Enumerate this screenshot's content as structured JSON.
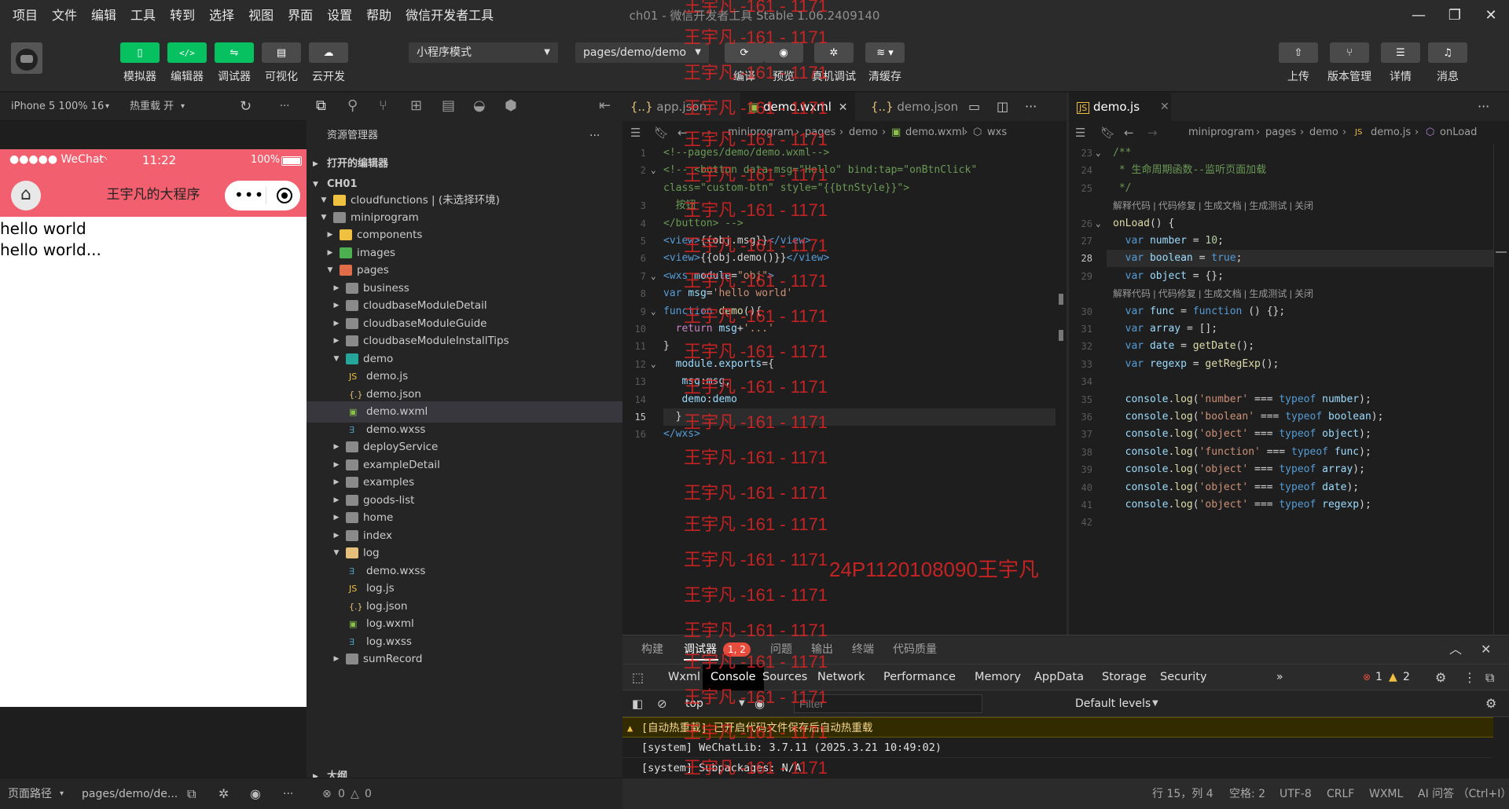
{
  "window": {
    "title": "ch01 - 微信开发者工具 Stable 1.06.2409140",
    "menu": [
      "项目",
      "文件",
      "编辑",
      "工具",
      "转到",
      "选择",
      "视图",
      "界面",
      "设置",
      "帮助",
      "微信开发者工具"
    ]
  },
  "toolbar": {
    "simulator": "模拟器",
    "editor": "编辑器",
    "debugger": "调试器",
    "visual": "可视化",
    "cloud": "云开发",
    "mode_select": "小程序模式",
    "page_select": "pages/demo/demo",
    "compile": "编译",
    "preview": "预览",
    "real_debug": "真机调试",
    "clear_cache": "清缓存",
    "upload": "上传",
    "version": "版本管理",
    "details": "详情",
    "messages": "消息"
  },
  "simulator": {
    "device": "iPhone 5 100% 16",
    "hot_reload": "热重载 开",
    "status_carrier": "●●●●● WeChat",
    "status_time": "11:22",
    "status_battery": "100%",
    "nav_title": "王宇凡的大程序",
    "content": [
      "hello world",
      "hello world..."
    ],
    "bottom_path_label": "页面路径",
    "bottom_path": "pages/demo/de..."
  },
  "explorer": {
    "title": "资源管理器",
    "open_editors": "打开的编辑器",
    "project": "CH01",
    "outline": "大纲",
    "items": [
      {
        "name": "cloudfunctions | (未选择环境)",
        "type": "folder"
      },
      {
        "name": "miniprogram",
        "type": "folder"
      },
      {
        "name": "components",
        "type": "folder"
      },
      {
        "name": "images",
        "type": "folder"
      },
      {
        "name": "pages",
        "type": "folder"
      },
      {
        "name": "business",
        "type": "folder"
      },
      {
        "name": "cloudbaseModuleDetail",
        "type": "folder"
      },
      {
        "name": "cloudbaseModuleGuide",
        "type": "folder"
      },
      {
        "name": "cloudbaseModuleInstallTips",
        "type": "folder"
      },
      {
        "name": "demo",
        "type": "folder"
      },
      {
        "name": "demo.js",
        "type": "js"
      },
      {
        "name": "demo.json",
        "type": "json"
      },
      {
        "name": "demo.wxml",
        "type": "wxml"
      },
      {
        "name": "demo.wxss",
        "type": "wxss"
      },
      {
        "name": "deployService",
        "type": "folder"
      },
      {
        "name": "exampleDetail",
        "type": "folder"
      },
      {
        "name": "examples",
        "type": "folder"
      },
      {
        "name": "goods-list",
        "type": "folder"
      },
      {
        "name": "home",
        "type": "folder"
      },
      {
        "name": "index",
        "type": "folder"
      },
      {
        "name": "log",
        "type": "folder"
      },
      {
        "name": "demo.wxss",
        "type": "wxss"
      },
      {
        "name": "log.js",
        "type": "js"
      },
      {
        "name": "log.json",
        "type": "json"
      },
      {
        "name": "log.wxml",
        "type": "wxml"
      },
      {
        "name": "log.wxss",
        "type": "wxss"
      },
      {
        "name": "sumRecord",
        "type": "folder"
      }
    ],
    "status_errors": "0",
    "status_warnings": "0"
  },
  "editor1": {
    "tabs": [
      "app.json",
      "demo.wxml",
      "demo.json"
    ],
    "breadcrumb": [
      "miniprogram",
      "pages",
      "demo",
      "demo.wxml",
      "wxs"
    ],
    "lines": [
      {
        "n": "1",
        "html": "<span class='c-com'>&lt;!--pages/demo/demo.wxml--&gt;</span>"
      },
      {
        "n": "2",
        "html": "<span class='c-com'>&lt;!-- &lt;button data-msg=\"Hello\" bind:tap=\"onBtnClick\"</span>"
      },
      {
        "n": "",
        "html": "<span class='c-com'>class=\"custom-btn\" style=\"{{btnStyle}}\"&gt;</span>"
      },
      {
        "n": "3",
        "html": "<span class='c-com'>  按钮</span>"
      },
      {
        "n": "4",
        "html": "<span class='c-com'>&lt;/button&gt; --&gt;</span>"
      },
      {
        "n": "5",
        "html": "<span class='c-tag'>&lt;view&gt;</span><span class='c-pl'>{{obj.msg}}</span><span class='c-tag'>&lt;/view&gt;</span>"
      },
      {
        "n": "6",
        "html": "<span class='c-tag'>&lt;view&gt;</span><span class='c-pl'>{{obj.demo()}}</span><span class='c-tag'>&lt;/view&gt;</span>"
      },
      {
        "n": "7",
        "html": "<span class='c-tag'>&lt;wxs</span> <span class='c-attr'>module</span><span class='c-pl'>=</span><span class='c-str'>\"obj\"</span><span class='c-tag'>&gt;</span>"
      },
      {
        "n": "8",
        "html": "<span class='c-kw2'>var</span> <span class='c-var'>msg</span><span class='c-pl'>=</span><span class='c-str'>'hello world'</span>"
      },
      {
        "n": "9",
        "html": "<span class='c-kw2'>function</span> <span class='c-fn'>demo</span><span class='c-pl'>(){</span>"
      },
      {
        "n": "10",
        "html": "  <span class='c-kw'>return</span> <span class='c-var'>msg</span><span class='c-pl'>+</span><span class='c-str'>'...'</span>"
      },
      {
        "n": "11",
        "html": "<span class='c-pl'>}</span>"
      },
      {
        "n": "12",
        "html": "  <span class='c-var'>module</span><span class='c-pl'>.</span><span class='c-var'>exports</span><span class='c-pl'>={</span>"
      },
      {
        "n": "13",
        "html": "   <span class='c-var'>msg</span><span class='c-pl'>:</span><span class='c-var'>msg</span><span class='c-pl'>,</span>"
      },
      {
        "n": "14",
        "html": "   <span class='c-var'>demo</span><span class='c-pl'>:</span><span class='c-var'>demo</span>"
      },
      {
        "n": "15",
        "html": "  <span class='c-pl'>}</span>"
      },
      {
        "n": "16",
        "html": "<span class='c-tag'>&lt;/wxs&gt;</span>"
      }
    ],
    "current_line": "15"
  },
  "editor2": {
    "tabs": [
      "demo.js"
    ],
    "breadcrumb": [
      "miniprogram",
      "pages",
      "demo",
      "demo.js",
      "onLoad"
    ],
    "codelens": "解释代码 | 代码修复 | 生成文档 | 生成测试 | 关闭",
    "lines": [
      {
        "n": "23",
        "html": "<span class='c-com'>/**</span>"
      },
      {
        "n": "24",
        "html": "<span class='c-com'> * 生命周期函数--监听页面加载</span>"
      },
      {
        "n": "25",
        "html": "<span class='c-com'> */</span>"
      },
      {
        "n": "",
        "lens": true
      },
      {
        "n": "26",
        "html": "<span class='c-fn'>onLoad</span><span class='c-pl'>() {</span>"
      },
      {
        "n": "27",
        "html": "  <span class='c-kw2'>var</span> <span class='c-var'>number</span> <span class='c-pl'>=</span> <span class='c-num'>10</span><span class='c-pl'>;</span>"
      },
      {
        "n": "28",
        "html": "  <span class='c-kw2'>var</span> <span class='c-var'>boolean</span> <span class='c-pl'>=</span> <span class='c-kw2'>true</span><span class='c-pl'>;</span>"
      },
      {
        "n": "29",
        "html": "  <span class='c-kw2'>var</span> <span class='c-var'>object</span> <span class='c-pl'>= {};</span>"
      },
      {
        "n": "",
        "lens": true
      },
      {
        "n": "30",
        "html": "  <span class='c-kw2'>var</span> <span class='c-var'>func</span> <span class='c-pl'>=</span> <span class='c-kw2'>function</span> <span class='c-pl'>() {};</span>"
      },
      {
        "n": "31",
        "html": "  <span class='c-kw2'>var</span> <span class='c-var'>array</span> <span class='c-pl'>= [];</span>"
      },
      {
        "n": "32",
        "html": "  <span class='c-kw2'>var</span> <span class='c-var'>date</span> <span class='c-pl'>=</span> <span class='c-fn'>getDate</span><span class='c-pl'>();</span>"
      },
      {
        "n": "33",
        "html": "  <span class='c-kw2'>var</span> <span class='c-var'>regexp</span> <span class='c-pl'>=</span> <span class='c-fn'>getRegExp</span><span class='c-pl'>();</span>"
      },
      {
        "n": "34",
        "html": ""
      },
      {
        "n": "35",
        "html": "  <span class='c-var'>console</span><span class='c-pl'>.</span><span class='c-fn'>log</span><span class='c-pl'>(</span><span class='c-str'>'number'</span> <span class='c-pl'>===</span> <span class='c-kw2'>typeof</span> <span class='c-var'>number</span><span class='c-pl'>);</span>"
      },
      {
        "n": "36",
        "html": "  <span class='c-var'>console</span><span class='c-pl'>.</span><span class='c-fn'>log</span><span class='c-pl'>(</span><span class='c-str'>'boolean'</span> <span class='c-pl'>===</span> <span class='c-kw2'>typeof</span> <span class='c-var'>boolean</span><span class='c-pl'>);</span>"
      },
      {
        "n": "37",
        "html": "  <span class='c-var'>console</span><span class='c-pl'>.</span><span class='c-fn'>log</span><span class='c-pl'>(</span><span class='c-str'>'object'</span> <span class='c-pl'>===</span> <span class='c-kw2'>typeof</span> <span class='c-var'>object</span><span class='c-pl'>);</span>"
      },
      {
        "n": "38",
        "html": "  <span class='c-var'>console</span><span class='c-pl'>.</span><span class='c-fn'>log</span><span class='c-pl'>(</span><span class='c-str'>'function'</span> <span class='c-pl'>===</span> <span class='c-kw2'>typeof</span> <span class='c-var'>func</span><span class='c-pl'>);</span>"
      },
      {
        "n": "39",
        "html": "  <span class='c-var'>console</span><span class='c-pl'>.</span><span class='c-fn'>log</span><span class='c-pl'>(</span><span class='c-str'>'object'</span> <span class='c-pl'>===</span> <span class='c-kw2'>typeof</span> <span class='c-var'>array</span><span class='c-pl'>);</span>"
      },
      {
        "n": "40",
        "html": "  <span class='c-var'>console</span><span class='c-pl'>.</span><span class='c-fn'>log</span><span class='c-pl'>(</span><span class='c-str'>'object'</span> <span class='c-pl'>===</span> <span class='c-kw2'>typeof</span> <span class='c-var'>date</span><span class='c-pl'>);</span>"
      },
      {
        "n": "41",
        "html": "  <span class='c-var'>console</span><span class='c-pl'>.</span><span class='c-fn'>log</span><span class='c-pl'>(</span><span class='c-str'>'object'</span> <span class='c-pl'>===</span> <span class='c-kw2'>typeof</span> <span class='c-var'>regexp</span><span class='c-pl'>);</span>"
      },
      {
        "n": "42",
        "html": ""
      }
    ],
    "current_line": "28"
  },
  "panel": {
    "tabs": [
      "构建",
      "调试器",
      "问题",
      "输出",
      "终端",
      "代码质量"
    ],
    "debugger_badge": "1, 2",
    "devtools_tabs": [
      "Wxml",
      "Console",
      "Sources",
      "Network",
      "Performance",
      "Memory",
      "AppData",
      "Storage",
      "Security"
    ],
    "more": "»",
    "error_count": "1",
    "warning_count": "2",
    "context": "top",
    "filter_placeholder": "Filter",
    "levels": "Default levels",
    "messages": [
      {
        "level": "warn",
        "text": "[自动热重载] 已开启代码文件保存后自动热重载"
      },
      {
        "level": "info",
        "text": "[system] WeChatLib: 3.7.11 (2025.3.21 10:49:02)"
      },
      {
        "level": "info",
        "text": "[system] Subpackages: N/A"
      }
    ]
  },
  "statusbar": {
    "position": "行 15，列 4",
    "spaces": "空格: 2",
    "encoding": "UTF-8",
    "eol": "CRLF",
    "language": "WXML",
    "ai": "AI 问答 （Ctrl+I）"
  },
  "watermark": {
    "text": "王宇凡 -161 - 1171",
    "extra": "24P1120108090王宇凡"
  },
  "colors": {
    "accent_green": "#07c160",
    "nav_pink": "#f25f6f",
    "watermark_red": "#e02525",
    "editor_bg": "#1e1e1e"
  }
}
